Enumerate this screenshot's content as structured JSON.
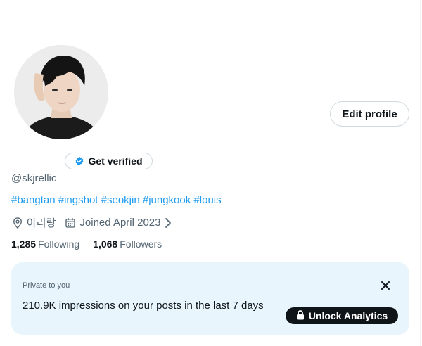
{
  "profile": {
    "handle": "@skjrellic",
    "location": "아리랑",
    "joined": "Joined April 2023",
    "hashtags": [
      "#bangtan",
      "#ingshot",
      "#seokjin",
      "#jungkook",
      "#louis"
    ]
  },
  "actions": {
    "edit_profile": "Edit profile",
    "get_verified": "Get verified"
  },
  "stats": {
    "following_count": "1,285",
    "following_label": "Following",
    "followers_count": "1,068",
    "followers_label": "Followers"
  },
  "analytics": {
    "private_label": "Private to you",
    "impressions_text": "210.9K impressions on your posts in the last 7 days",
    "unlock_label": "Unlock Analytics"
  },
  "icons": {
    "verified": "verified-badge-icon",
    "location": "location-pin-icon",
    "calendar": "calendar-icon",
    "chevron": "chevron-right-icon",
    "close": "close-icon",
    "lock": "lock-icon"
  },
  "colors": {
    "accent": "#1d9bf0",
    "text_primary": "#0f1419",
    "text_secondary": "#536471",
    "analytics_bg": "#e8f5fd",
    "button_dark": "#0f1419"
  }
}
